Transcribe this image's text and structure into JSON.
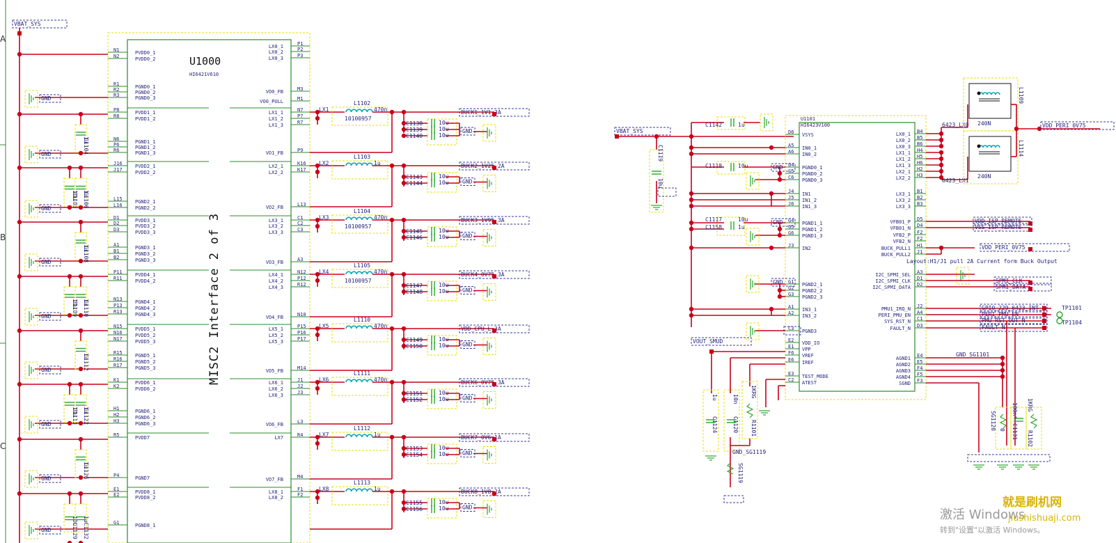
{
  "colors": {
    "wire": "#c8001a",
    "box": "#2b8a2b",
    "dash": "#e8e000",
    "net": "#3a3a9a",
    "text": "#1f1f7a",
    "ind": "#0aa7b8",
    "cap": "#2aa52a"
  },
  "left": {
    "vbat_net": "VBAT_SYS",
    "ref": "U1000",
    "part": "HI6421V610",
    "interface": "MISC2 Interface 2 of 3",
    "side_letters": [
      "A",
      "B",
      "C"
    ],
    "left_pins": [
      {
        "n": "N1",
        "name": "PVDD0_1"
      },
      {
        "n": "N2",
        "name": "PVDD0_2"
      },
      {
        "n": "R1",
        "name": "PGND0_1"
      },
      {
        "n": "R2",
        "name": "PGND0_2"
      },
      {
        "n": "R3",
        "name": "PGND0_3"
      },
      {
        "n": "P8",
        "name": "PVDD1_1"
      },
      {
        "n": "R8",
        "name": "PVDD1_2"
      },
      {
        "n": "N6",
        "name": "PGND1_1"
      },
      {
        "n": "P6",
        "name": "PGND1_2"
      },
      {
        "n": "R6",
        "name": "PGND1_3"
      },
      {
        "n": "J16",
        "name": "PVDD2_1"
      },
      {
        "n": "J17",
        "name": "PVDD2_2"
      },
      {
        "n": "L15",
        "name": "PGND2_1"
      },
      {
        "n": "L16",
        "name": "PGND2_2"
      },
      {
        "n": "D1",
        "name": "PVDD3_1"
      },
      {
        "n": "D2",
        "name": "PVDD3_2"
      },
      {
        "n": "D3",
        "name": "PVDD3_3"
      },
      {
        "n": "A1",
        "name": "PGND3_1"
      },
      {
        "n": "B1",
        "name": "PGND3_2"
      },
      {
        "n": "B2",
        "name": "PGND3_3"
      },
      {
        "n": "P11",
        "name": "PVDD4_1"
      },
      {
        "n": "R11",
        "name": "PVDD4_2"
      },
      {
        "n": "N13",
        "name": "PGND4_1"
      },
      {
        "n": "P13",
        "name": "PGND4_2"
      },
      {
        "n": "R13",
        "name": "PGND4_3"
      },
      {
        "n": "N15",
        "name": "PVDD5_1"
      },
      {
        "n": "N16",
        "name": "PVDD5_2"
      },
      {
        "n": "N17",
        "name": "PVDD5_3"
      },
      {
        "n": "R15",
        "name": "PGND5_1"
      },
      {
        "n": "R16",
        "name": "PGND5_2"
      },
      {
        "n": "R17",
        "name": "PGND5_3"
      },
      {
        "n": "K1",
        "name": "PVDD6_1"
      },
      {
        "n": "K2",
        "name": "PVDD6_2"
      },
      {
        "n": "H1",
        "name": "PGND6_1"
      },
      {
        "n": "H2",
        "name": "PGND6_2"
      },
      {
        "n": "H3",
        "name": "PGND6_3"
      },
      {
        "n": "R5",
        "name": "PVDD7"
      },
      {
        "n": "P4",
        "name": "PGND7"
      },
      {
        "n": "E1",
        "name": "PVDD8_1"
      },
      {
        "n": "E2",
        "name": "PVDD8_2"
      },
      {
        "n": "G1",
        "name": "PGND8_1"
      }
    ],
    "right_pins": [
      {
        "n": "P1",
        "name": "LX0_1"
      },
      {
        "n": "P2",
        "name": "LX0_2"
      },
      {
        "n": "P3",
        "name": "LX0_3"
      },
      {
        "n": "M3",
        "name": "VO0_FB"
      },
      {
        "n": "M1",
        "name": "VO0_PULL"
      },
      {
        "n": "N7",
        "name": "LX1_1"
      },
      {
        "n": "P7",
        "name": "LX1_2"
      },
      {
        "n": "R7",
        "name": "LX1_3"
      },
      {
        "n": "P9",
        "name": "VO1_FB"
      },
      {
        "n": "K16",
        "name": "LX2_1"
      },
      {
        "n": "K17",
        "name": "LX2_2"
      },
      {
        "n": "L13",
        "name": "VO2_FB"
      },
      {
        "n": "C1",
        "name": "LX3_1"
      },
      {
        "n": "C2",
        "name": "LX3_2"
      },
      {
        "n": "C3",
        "name": "LX3_3"
      },
      {
        "n": "A3",
        "name": "VO3_FB"
      },
      {
        "n": "N12",
        "name": "LX4_1"
      },
      {
        "n": "P12",
        "name": "LX4_2"
      },
      {
        "n": "R12",
        "name": "LX4_3"
      },
      {
        "n": "N10",
        "name": "VO4_FB"
      },
      {
        "n": "P15",
        "name": "LX5_1"
      },
      {
        "n": "P16",
        "name": "LX5_2"
      },
      {
        "n": "P17",
        "name": "LX5_3"
      },
      {
        "n": "M14",
        "name": "VO5_FB"
      },
      {
        "n": "J1",
        "name": "LX6_1"
      },
      {
        "n": "J2",
        "name": "LX6_2"
      },
      {
        "n": "J3",
        "name": "LX6_3"
      },
      {
        "n": "L3",
        "name": "VO6_FB"
      },
      {
        "n": "R4",
        "name": "LX7"
      },
      {
        "n": "M4",
        "name": "VO7_FB"
      },
      {
        "n": "F1",
        "name": "LX8_1"
      },
      {
        "n": "F2",
        "name": "LX8_2"
      }
    ],
    "bucks": [
      {
        "lx": "LX1",
        "ind": "L1102",
        "val": "470n",
        "pn": "10100957",
        "caps": [
          "C1138",
          "C1139",
          "C1140"
        ],
        "cv": [
          "10u",
          "10u",
          "10u"
        ],
        "out": "BUCK1_1V1_3A"
      },
      {
        "lx": "LX2",
        "ind": "L1103",
        "val": "1u",
        "pn": "",
        "caps": [
          "C1143",
          "C1144"
        ],
        "cv": [
          "10u",
          "10u"
        ],
        "out": "BUCK2_1V25_2A"
      },
      {
        "lx": "LX3",
        "ind": "L1104",
        "val": "470n",
        "pn": "10100957",
        "caps": [
          "C1145",
          "C1146"
        ],
        "cv": [
          "10u",
          "10u"
        ],
        "out": "BUCK3_1V95_3A"
      },
      {
        "lx": "LX4",
        "ind": "L1105",
        "val": "470n",
        "pn": "10100957",
        "caps": [
          "C1147",
          "C1148"
        ],
        "cv": [
          "10u",
          "10u"
        ],
        "out": "BUCK4_0V75_3A"
      },
      {
        "lx": "LX5",
        "ind": "L1110",
        "val": "470n",
        "pn": "",
        "caps": [
          "C1149",
          "C1150"
        ],
        "cv": [
          "10u",
          "10u"
        ],
        "out": "VDD_CPU_L_3A"
      },
      {
        "lx": "LX6",
        "ind": "L1111",
        "val": "470n",
        "pn": "",
        "caps": [
          "C1151",
          "C1152"
        ],
        "cv": [
          "10u",
          "10u"
        ],
        "out": "BUCK6_0V75_3A"
      },
      {
        "lx": "LX7",
        "ind": "L1112",
        "val": "1u",
        "pn": "",
        "caps": [
          "C1153",
          "C1154"
        ],
        "cv": [
          "10u",
          "10u"
        ],
        "out": "BUCK7_0V6_1A"
      },
      {
        "lx": "LX8",
        "ind": "L1113",
        "val": "1u",
        "pn": "",
        "caps": [
          "C1155",
          "C1156"
        ],
        "cv": [
          "10u",
          "10u"
        ],
        "out": "BUCK8_1V8_2A"
      }
    ],
    "decaps": [
      {
        "ref": "C1104",
        "val": "1u"
      },
      {
        "ref": "C1105",
        "val": "10u"
      },
      {
        "ref": "C1106",
        "val": "1u"
      },
      {
        "ref": "C1108",
        "val": "1u"
      },
      {
        "ref": "C1109",
        "val": "10u"
      },
      {
        "ref": "C1110",
        "val": "1u"
      },
      {
        "ref": "C1112",
        "val": "1u"
      },
      {
        "ref": "C1113",
        "val": "10u"
      },
      {
        "ref": "C1122",
        "val": "1u"
      },
      {
        "ref": "C1126",
        "val": "1u"
      },
      {
        "ref": "C1129",
        "val": "10u"
      },
      {
        "ref": "C1132",
        "val": "1u"
      }
    ],
    "gnd": "GND"
  },
  "right": {
    "vbat_net": "VBAT_SYS",
    "ref": "U1101",
    "part": "HI6423V100",
    "left_pins": [
      {
        "n": "D6",
        "name": "VSYS"
      },
      {
        "n": "A5",
        "name": "IN0_1"
      },
      {
        "n": "A6",
        "name": "IN0_2"
      },
      {
        "n": "G4",
        "name": "PGND0_1"
      },
      {
        "n": "C5",
        "name": "PGND0_2"
      },
      {
        "n": "C6",
        "name": "PGND0_3"
      },
      {
        "n": "J4",
        "name": "IN1"
      },
      {
        "n": "J5",
        "name": "IN1_2"
      },
      {
        "n": "J6",
        "name": "IN1_3"
      },
      {
        "n": "G4",
        "name": "PGND1_1"
      },
      {
        "n": "G5",
        "name": "PGND1_2"
      },
      {
        "n": "G6",
        "name": "PGND1_3"
      },
      {
        "n": "J3",
        "name": "IN2"
      },
      {
        "n": "G1",
        "name": "PGND2_1"
      },
      {
        "n": "G2",
        "name": "PGND2_2"
      },
      {
        "n": "G3",
        "name": "PGND2_3"
      },
      {
        "n": "A1",
        "name": "IN3_1"
      },
      {
        "n": "A2",
        "name": "IN3_2"
      },
      {
        "n": "C3",
        "name": "PGND3"
      },
      {
        "n": "E2",
        "name": "VDD_IO"
      },
      {
        "n": "E1",
        "name": "VPP"
      },
      {
        "n": "F6",
        "name": "VREF"
      },
      {
        "n": "E6",
        "name": "IREF"
      },
      {
        "n": "E3",
        "name": "TEST_MODE"
      },
      {
        "n": "C2",
        "name": "ATEST"
      }
    ],
    "right_pins": [
      {
        "n": "B4",
        "name": "LX0_1"
      },
      {
        "n": "B5",
        "name": "LX0_2"
      },
      {
        "n": "B6",
        "name": "LX0_3"
      },
      {
        "n": "H4",
        "name": "LX1_1"
      },
      {
        "n": "H5",
        "name": "LX1_2"
      },
      {
        "n": "H6",
        "name": "LX1_3"
      },
      {
        "n": "H2",
        "name": "LX2_1"
      },
      {
        "n": "H3",
        "name": "LX2_2"
      },
      {
        "n": "B1",
        "name": "LX3_1"
      },
      {
        "n": "B2",
        "name": "LX3_2"
      },
      {
        "n": "B3",
        "name": "LX3_3"
      },
      {
        "n": "D5",
        "name": "VFB01_P"
      },
      {
        "n": "D4",
        "name": "VFB01_N"
      },
      {
        "n": "F2",
        "name": "VFB2_P"
      },
      {
        "n": "F2",
        "name": "VFB2_N"
      },
      {
        "n": "H1",
        "name": "BUCK_PULL1"
      },
      {
        "n": "J1",
        "name": "BUCK_PULL2"
      },
      {
        "n": "A3",
        "name": "I2C_SPMI_SEL"
      },
      {
        "n": "D1",
        "name": "I2C_SPMI_CLK"
      },
      {
        "n": "D2",
        "name": "I2C_SPMI_DATA"
      },
      {
        "n": "J2",
        "name": "PMU1_IRQ_N"
      },
      {
        "n": "A4",
        "name": "PERI_PMU_EN"
      },
      {
        "n": "C1",
        "name": "SYS_RST_N"
      },
      {
        "n": "D3",
        "name": "FAULT_N"
      },
      {
        "n": "E4",
        "name": "AGND1"
      },
      {
        "n": "E5",
        "name": "AGND2"
      },
      {
        "n": "F4",
        "name": "AGND3"
      },
      {
        "n": "F5",
        "name": "AGND4"
      },
      {
        "n": "F3",
        "name": "SGND"
      }
    ],
    "nets": {
      "lx0": "6423_LX0",
      "lx1": "6423_LX1",
      "peri": "VDD_PERI_0V75",
      "isp_p": "VDD_ISP_REMOTE",
      "isp_n": "VSS_ISP_REMOTE",
      "peri2": "VDD_PERI_0V75",
      "clk": "SPMI_CLK",
      "dat": "SPMI_DATA",
      "gpio": "GPIO_229_6423_INT_N",
      "pmu_en": "PERI_PMU_EN",
      "rst": "PMU_RST_OUT_N",
      "fault": "FAULT_N",
      "vout": "VOUT_SMUD",
      "gnd_sg": "GND_SG1101",
      "gnd_sg2": "GND_SG1119",
      "gnd": "GND",
      "tp1": "TP1101",
      "tp2": "TP1104"
    },
    "layout_note": "Layout:H1/J1 pull 2A Current form Buck Output",
    "inductors": [
      {
        "ref": "L1109",
        "val": "240N"
      },
      {
        "ref": "L1114",
        "val": "240N"
      }
    ],
    "caps": [
      {
        "ref": "C1142",
        "val": "1u"
      },
      {
        "ref": "C1119",
        "val": "10u"
      },
      {
        "ref": "C1118",
        "val": "10u"
      },
      {
        "ref": "C1117",
        "val": "10u"
      },
      {
        "ref": "C1158",
        "val": "1u"
      },
      {
        "ref": "C1124",
        "val": "1u"
      },
      {
        "ref": "C1120",
        "val": "10n"
      },
      {
        "ref": "R1101",
        "val": "1KRG"
      },
      {
        "ref": "SG1119",
        "val": "0"
      },
      {
        "ref": "SG1120",
        "val": "0"
      },
      {
        "ref": "C1131",
        "val": "100n*"
      },
      {
        "ref": "R1102",
        "val": "1KRG"
      }
    ]
  },
  "watermark": {
    "line1": "激活 Windows",
    "line2": "转到\"设置\"以激活 Windows。",
    "site_cn": "就是刷机网",
    "site_url": "jiushishuaji.com"
  }
}
